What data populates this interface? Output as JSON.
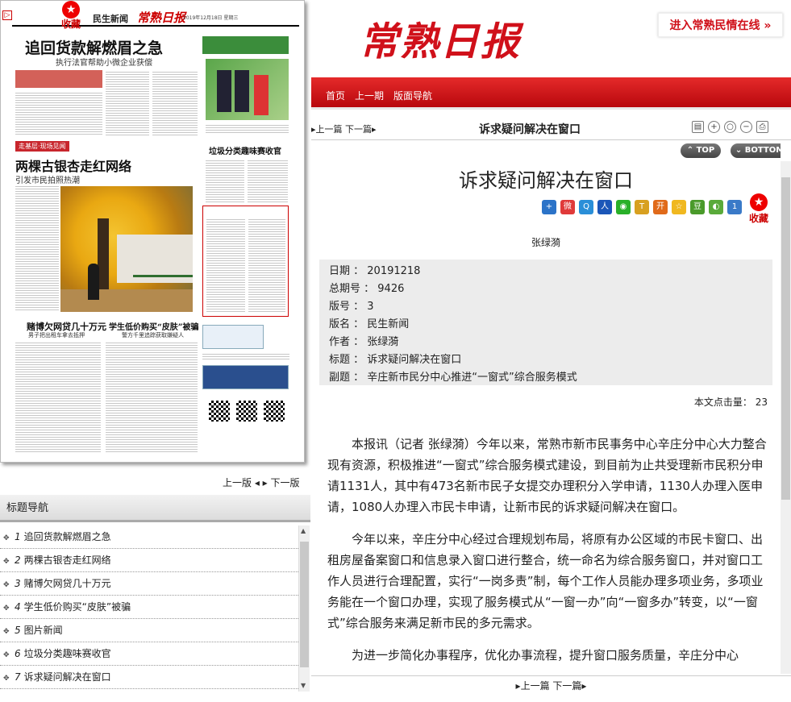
{
  "newspaper_page": {
    "fav_label": "收藏",
    "section_name": "民生新闻",
    "paper_logo": "常熟日报",
    "date_line": "2019年12月18日 星期三",
    "lead_headline": "追回货款解燃眉之急",
    "lead_subhead": "执行法官帮助小微企业获偿",
    "red_banner": "走基层·现场见闻",
    "tree_headline": "两棵古银杏走红网络",
    "tree_subhead": "引发市民拍照热潮",
    "side_headline": "垃圾分类趣味赛收官",
    "gamble_headline": "赌博欠网贷几十万元",
    "gamble_subhead": "男子把出租车拿去抵押",
    "skin_headline": "学生低价购买“皮肤”被骗",
    "skin_subhead": "警方千里追踪获取嫌疑人"
  },
  "left_pager": {
    "prev": "上一版",
    "next": "下一版"
  },
  "nav": {
    "title": "标题导航",
    "items": [
      {
        "num": "1",
        "label": "追回货款解燃眉之急"
      },
      {
        "num": "2",
        "label": "两棵古银杏走红网络"
      },
      {
        "num": "3",
        "label": "赌博欠网贷几十万元"
      },
      {
        "num": "4",
        "label": "学生低价购买“皮肤”被骗"
      },
      {
        "num": "5",
        "label": "图片新闻"
      },
      {
        "num": "6",
        "label": "垃圾分类趣味赛收官"
      },
      {
        "num": "7",
        "label": "诉求疑问解决在窗口"
      }
    ]
  },
  "masthead": {
    "brand": "常熟日报",
    "enter_link": "进入常熟民情在线 »"
  },
  "menu": {
    "home": "首页",
    "prev_issue": "上一期",
    "page_nav": "版面导航"
  },
  "toolbar": {
    "prev": "上一篇",
    "next": "下一篇",
    "title": "诉求疑问解决在窗口"
  },
  "pills": {
    "top": "TOP",
    "bottom": "BOTTOM"
  },
  "article": {
    "title": "诉求疑问解决在窗口",
    "fav_label": "收藏",
    "author": "张绿漪",
    "meta": [
      {
        "key": "日期",
        "value": "20191218"
      },
      {
        "key": "总期号",
        "value": "9426"
      },
      {
        "key": "版号",
        "value": "3"
      },
      {
        "key": "版名",
        "value": "民生新闻"
      },
      {
        "key": "作者",
        "value": "张绿漪"
      },
      {
        "key": "标题",
        "value": "诉求疑问解决在窗口"
      },
      {
        "key": "副题",
        "value": "辛庄新市民分中心推进“一窗式”综合服务模式"
      }
    ],
    "wordcount_label": "本文点击量：",
    "wordcount": "23",
    "paragraphs": [
      "本报讯（记者 张绿漪）今年以来，常熟市新市民事务中心辛庄分中心大力整合现有资源，积极推进“一窗式”综合服务模式建设，到目前为止共受理新市民积分申请1131人，其中有473名新市民子女提交办理积分入学申请，1130人办理入医申请，1080人办理入市民卡申请，让新市民的诉求疑问解决在窗口。",
      "今年以来，辛庄分中心经过合理规划布局，将原有办公区域的市民卡窗口、出租房屋备案窗口和信息录入窗口进行整合，统一命名为综合服务窗口，并对窗口工作人员进行合理配置，实行“一岗多责”制，每个工作人员能办理多项业务，多项业务能在一个窗口办理，实现了服务模式从“一窗一办”向“一窗多办”转变，以“一窗式”综合服务来满足新市民的多元需求。",
      "为进一步简化办事程序，优化办事流程，提升窗口服务质量，辛庄分中心"
    ]
  },
  "bottom_pager": {
    "prev": "上一篇",
    "next": "下一篇"
  },
  "colors": {
    "brand_red": "#d0101a",
    "menu_red": "#c8101a"
  }
}
